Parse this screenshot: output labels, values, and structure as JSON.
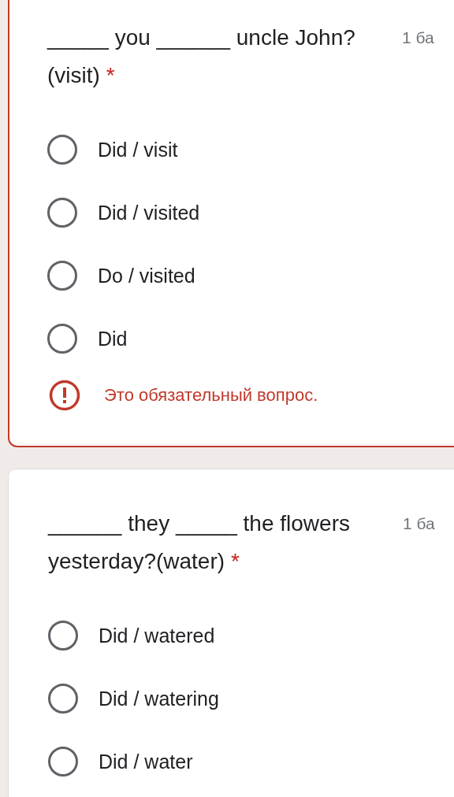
{
  "questions": [
    {
      "text": "_____ you ______ uncle John? (visit)",
      "required_mark": "*",
      "points": "1 ба",
      "options": [
        {
          "label": "Did / visit",
          "selected": false
        },
        {
          "label": "Did / visited",
          "selected": false
        },
        {
          "label": "Do / visited",
          "selected": false
        },
        {
          "label": "Did",
          "selected": false
        }
      ],
      "error": "Это обязательный вопрос."
    },
    {
      "text": "______ they _____ the flowers yesterday?(water)",
      "required_mark": "*",
      "points": "1 ба",
      "options": [
        {
          "label": "Did / watered",
          "selected": false
        },
        {
          "label": "Did / watering",
          "selected": false
        },
        {
          "label": "Did / water",
          "selected": false
        }
      ]
    }
  ]
}
